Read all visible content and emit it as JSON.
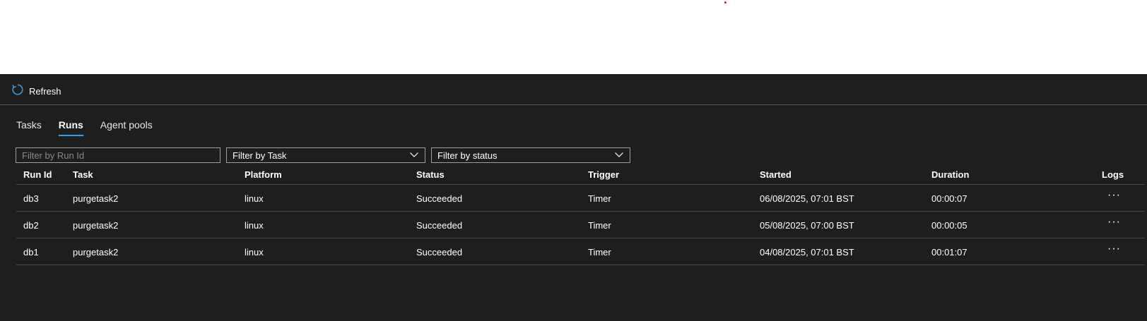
{
  "toolbar": {
    "refresh_label": "Refresh"
  },
  "tabs": [
    {
      "label": "Tasks",
      "active": false
    },
    {
      "label": "Runs",
      "active": true
    },
    {
      "label": "Agent pools",
      "active": false
    }
  ],
  "filters": {
    "run_id_placeholder": "Filter by Run Id",
    "task_label": "Filter by Task",
    "status_label": "Filter by status"
  },
  "table": {
    "headers": {
      "run_id": "Run Id",
      "task": "Task",
      "platform": "Platform",
      "status": "Status",
      "trigger": "Trigger",
      "started": "Started",
      "duration": "Duration",
      "logs": "Logs"
    },
    "rows": [
      {
        "run_id": "db3",
        "task": "purgetask2",
        "platform": "linux",
        "status": "Succeeded",
        "trigger": "Timer",
        "started": "06/08/2025, 07:01 BST",
        "duration": "00:00:07",
        "logs": "···"
      },
      {
        "run_id": "db2",
        "task": "purgetask2",
        "platform": "linux",
        "status": "Succeeded",
        "trigger": "Timer",
        "started": "05/08/2025, 07:00 BST",
        "duration": "00:00:05",
        "logs": "···"
      },
      {
        "run_id": "db1",
        "task": "purgetask2",
        "platform": "linux",
        "status": "Succeeded",
        "trigger": "Timer",
        "started": "04/08/2025, 07:01 BST",
        "duration": "00:01:07",
        "logs": "···"
      }
    ]
  },
  "colors": {
    "panel_bg": "#1f1e1e",
    "accent": "#3a9eea",
    "divider": "#4a4948"
  }
}
